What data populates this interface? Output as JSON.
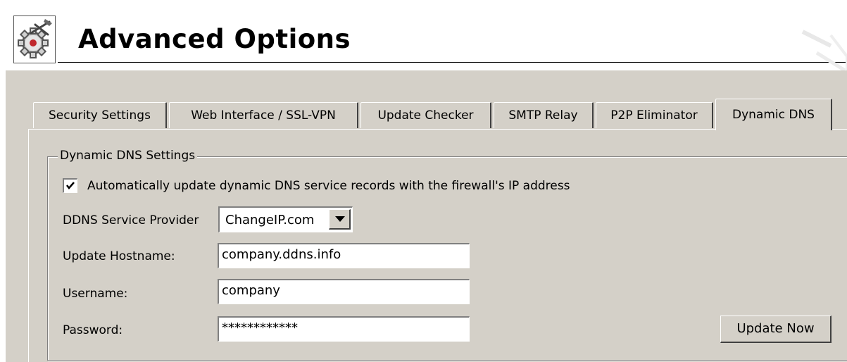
{
  "header": {
    "title": "Advanced Options",
    "icon": "gear-tools-icon"
  },
  "tabs": [
    {
      "label": "Security Settings",
      "active": false
    },
    {
      "label": "Web Interface / SSL-VPN",
      "active": false
    },
    {
      "label": "Update Checker",
      "active": false
    },
    {
      "label": "SMTP Relay",
      "active": false
    },
    {
      "label": "P2P Eliminator",
      "active": false
    },
    {
      "label": "Dynamic DNS",
      "active": true
    }
  ],
  "ddns": {
    "group_title": "Dynamic DNS Settings",
    "auto_update": {
      "label": "Automatically update dynamic DNS service records with the firewall's IP address",
      "checked": true
    },
    "provider": {
      "label": "DDNS Service Provider",
      "selected": "ChangeIP.com"
    },
    "hostname": {
      "label": "Update Hostname:",
      "value": "company.ddns.info"
    },
    "username": {
      "label": "Username:",
      "value": "company"
    },
    "password": {
      "label": "Password:",
      "value": "************"
    },
    "update_button": "Update Now"
  },
  "colors": {
    "panel_bg": "#d4d0c8",
    "icon_accent": "#c0282d"
  }
}
